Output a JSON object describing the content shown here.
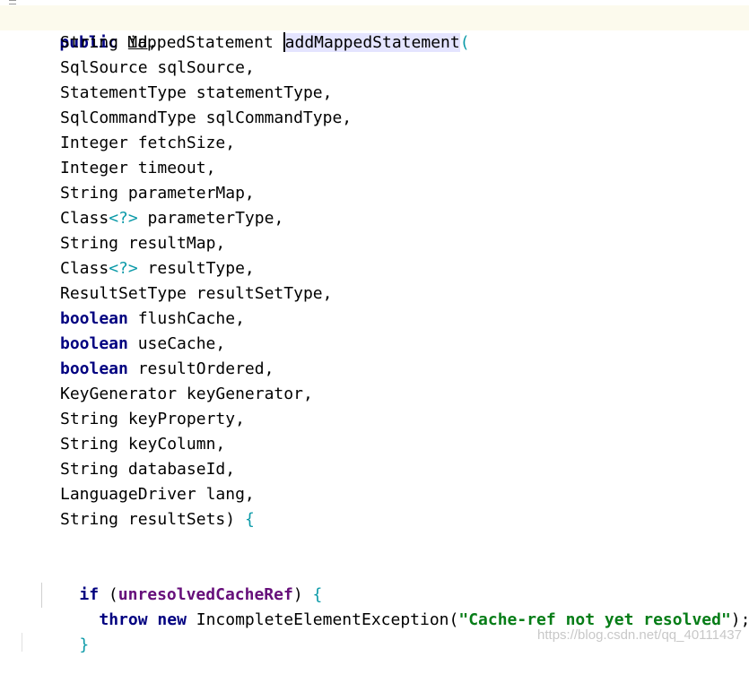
{
  "signature": {
    "modifier": "public",
    "return_type": "MappedStatement",
    "method_name": "addMappedStatement",
    "open_paren": "("
  },
  "params": [
    {
      "type": "String",
      "name": "id"
    },
    {
      "type": "SqlSource",
      "name": "sqlSource"
    },
    {
      "type": "StatementType",
      "name": "statementType"
    },
    {
      "type": "SqlCommandType",
      "name": "sqlCommandType"
    },
    {
      "type": "Integer",
      "name": "fetchSize"
    },
    {
      "type": "Integer",
      "name": "timeout"
    },
    {
      "type": "String",
      "name": "parameterMap"
    },
    {
      "type": "Class",
      "generic": "<?>",
      "name": "parameterType"
    },
    {
      "type": "String",
      "name": "resultMap"
    },
    {
      "type": "Class",
      "generic": "<?>",
      "name": "resultType"
    },
    {
      "type": "ResultSetType",
      "name": "resultSetType"
    },
    {
      "type": "boolean",
      "name": "flushCache"
    },
    {
      "type": "boolean",
      "name": "useCache"
    },
    {
      "type": "boolean",
      "name": "resultOrdered"
    },
    {
      "type": "KeyGenerator",
      "name": "keyGenerator"
    },
    {
      "type": "String",
      "name": "keyProperty"
    },
    {
      "type": "String",
      "name": "keyColumn"
    },
    {
      "type": "String",
      "name": "databaseId"
    },
    {
      "type": "LanguageDriver",
      "name": "lang"
    },
    {
      "type": "String",
      "name": "resultSets"
    }
  ],
  "punct": {
    "comma": ",",
    "close_paren_brace": ") ",
    "open_brace": "{",
    "close_brace": "}",
    "space": " "
  },
  "body": {
    "if_keyword": "if",
    "if_open": "(",
    "condition_field": "unresolvedCacheRef",
    "if_close": ") ",
    "if_brace": "{",
    "throw_keyword": "throw",
    "new_keyword": "new",
    "exception_class": "IncompleteElementException",
    "call_open": "(",
    "message": "\"Cache-ref not yet resolved\"",
    "call_close": ");",
    "closing_brace": "}"
  },
  "watermark": "https://blog.csdn.net/qq_40111437",
  "colors": {
    "keyword": "#000080",
    "field": "#660e7a",
    "string": "#067d17",
    "wildcard": "#0b9aa8",
    "current_line_bg": "#fcfaed",
    "identifier_highlight": "#e4e4ff"
  }
}
